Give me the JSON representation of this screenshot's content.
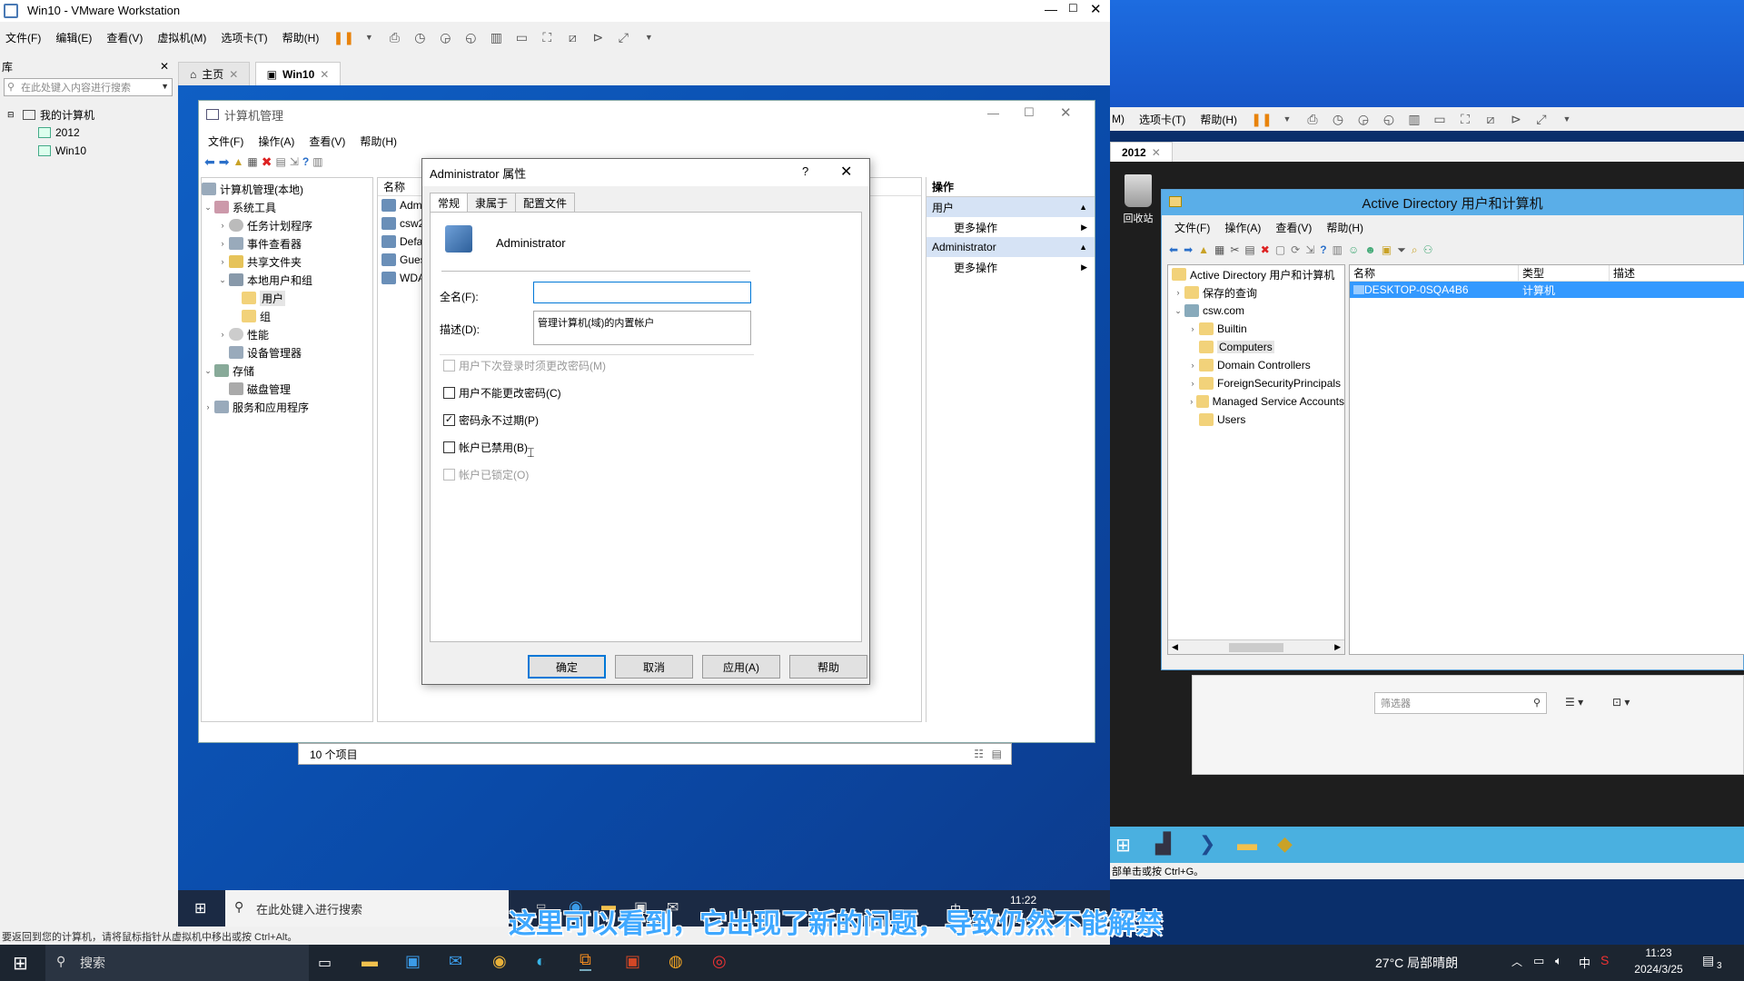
{
  "host_window": {
    "title": "Win10 - VMware Workstation",
    "menu": [
      "文件(F)",
      "编辑(E)",
      "查看(V)",
      "虚拟机(M)",
      "选项卡(T)",
      "帮助(H)"
    ],
    "library_label": "库",
    "library_search_placeholder": "在此处键入内容进行搜索",
    "library_tree": [
      "我的计算机",
      "2012",
      "Win10"
    ],
    "tabs": [
      "主页",
      "Win10"
    ],
    "status_text": "要返回到您的计算机，请将鼠标指针从虚拟机中移出或按 Ctrl+Alt。"
  },
  "computer_management": {
    "title": "计算机管理",
    "menu": [
      "文件(F)",
      "操作(A)",
      "查看(V)",
      "帮助(H)"
    ],
    "tree": [
      "计算机管理(本地)",
      "系统工具",
      "任务计划程序",
      "事件查看器",
      "共享文件夹",
      "本地用户和组",
      "用户",
      "组",
      "性能",
      "设备管理器",
      "存储",
      "磁盘管理",
      "服务和应用程序"
    ],
    "list_header": "名称",
    "list_items": [
      "Admi",
      "csw2",
      "Defa",
      "Gues",
      "WDA"
    ],
    "actions_header": "操作",
    "actions_section1": "用户",
    "actions_section1_item": "更多操作",
    "actions_section2": "Administrator",
    "actions_section2_item": "更多操作",
    "status": "10 个项目"
  },
  "dialog": {
    "title": "Administrator 属性",
    "help_glyph": "?",
    "tabs": [
      "常规",
      "隶属于",
      "配置文件"
    ],
    "user_name": "Administrator",
    "fullname_label": "全名(F):",
    "fullname_value": "",
    "description_label": "描述(D):",
    "description_value": "管理计算机(域)的内置帐户",
    "checkboxes": [
      {
        "label": "用户下次登录时须更改密码(M)",
        "checked": false,
        "disabled": true
      },
      {
        "label": "用户不能更改密码(C)",
        "checked": false,
        "disabled": false
      },
      {
        "label": "密码永不过期(P)",
        "checked": true,
        "disabled": false
      },
      {
        "label": "帐户已禁用(B)",
        "checked": false,
        "disabled": false
      },
      {
        "label": "帐户已锁定(O)",
        "checked": false,
        "disabled": true
      }
    ],
    "buttons": {
      "ok": "确定",
      "cancel": "取消",
      "apply": "应用(A)",
      "help": "帮助"
    }
  },
  "guest_taskbar": {
    "search_placeholder": "在此处键入进行搜索",
    "clock_time": "11:22",
    "ime": "中"
  },
  "right_vm": {
    "menu": [
      "M)",
      "选项卡(T)",
      "帮助(H)"
    ],
    "tab": "2012",
    "recycle_bin": "回收站",
    "ad": {
      "title": "Active Directory 用户和计算机",
      "menu": [
        "文件(F)",
        "操作(A)",
        "查看(V)",
        "帮助(H)"
      ],
      "tree": [
        "Active Directory 用户和计算机",
        "保存的查询",
        "csw.com",
        "Builtin",
        "Computers",
        "Domain Controllers",
        "ForeignSecurityPrincipals",
        "Managed Service Accounts",
        "Users"
      ],
      "columns": [
        "名称",
        "类型",
        "描述"
      ],
      "rows": [
        {
          "name": "DESKTOP-0SQA4B6",
          "type": "计算机",
          "desc": ""
        }
      ]
    },
    "filter_placeholder": "筛选器",
    "status_text": "部单击或按 Ctrl+G。"
  },
  "host_taskbar": {
    "search": "搜索",
    "weather": "27°C 局部晴朗",
    "ime": "中",
    "time": "11:23",
    "date": "2024/3/25",
    "notification_count": "3"
  },
  "subtitle": "这里可以看到，它出现了新的问题，导致仍然不能解禁",
  "colors": {
    "accent": "#0078d7",
    "ad_title": "#5aaee8",
    "selection": "#3399ff",
    "subtitle": "#3fa8ff"
  }
}
